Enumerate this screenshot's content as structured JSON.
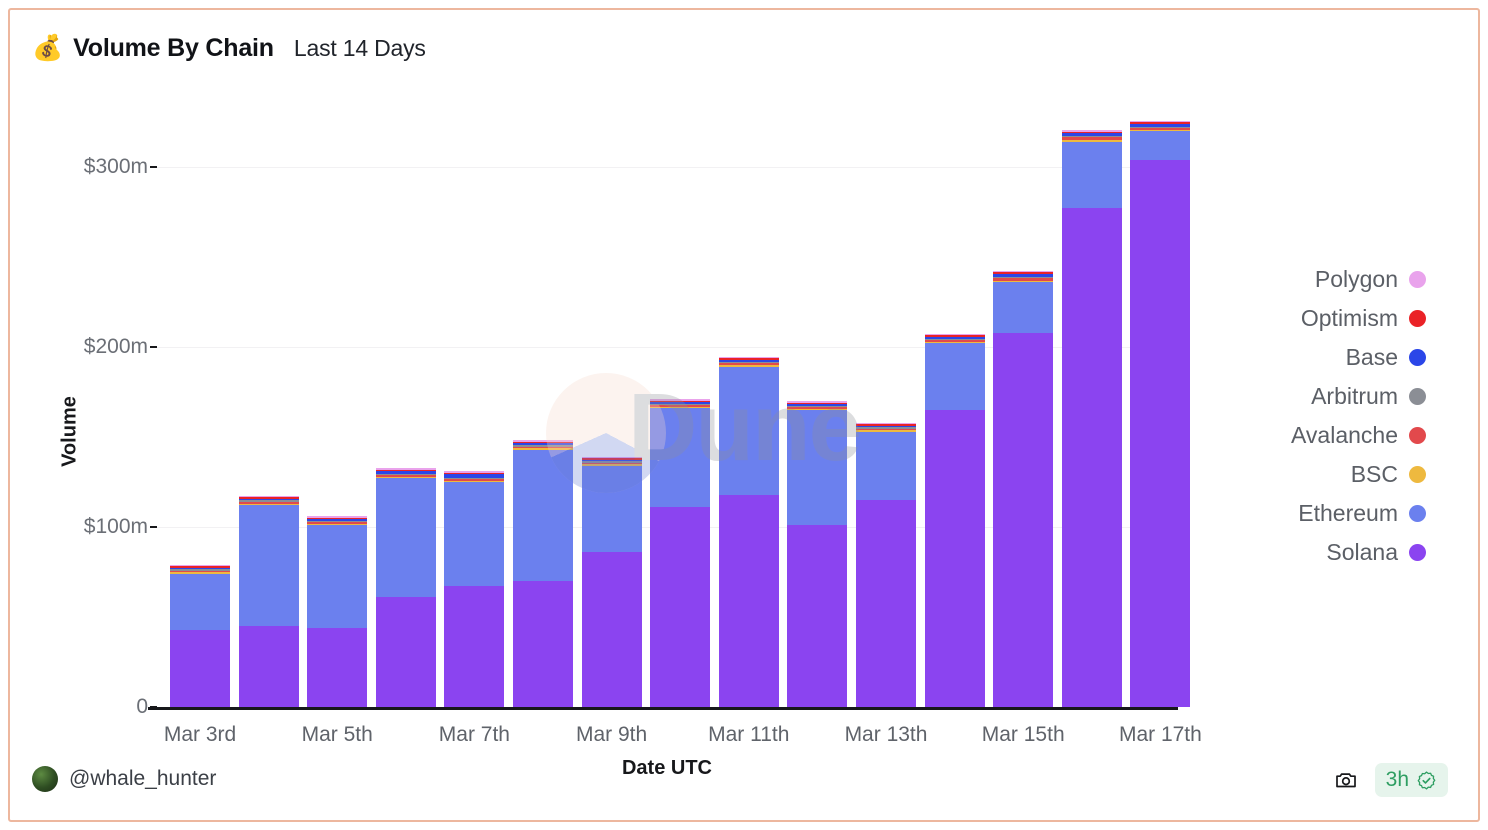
{
  "card": {
    "border_color": "#edb79e",
    "background": "#ffffff"
  },
  "header": {
    "icon": "money-bag-icon",
    "icon_glyph": "💰",
    "title": "Volume By Chain",
    "subtitle": "Last 14 Days"
  },
  "footer": {
    "username": "@whale_hunter",
    "camera_icon": "camera-icon",
    "freshness": "3h",
    "verified_icon": "verified-check-icon"
  },
  "watermark": {
    "text": "Dune"
  },
  "chart_data": {
    "type": "bar",
    "stacked": true,
    "title": "Volume By Chain",
    "subtitle": "Last 14 Days",
    "xlabel": "Date UTC",
    "ylabel": "Volume",
    "ylim": [
      0,
      330
    ],
    "yticks": [
      0,
      100,
      200,
      300
    ],
    "ytick_labels": [
      "0",
      "$100m",
      "$200m",
      "$300m"
    ],
    "units": "USD millions",
    "grid": true,
    "legend_position": "right",
    "categories": [
      "Mar 3rd",
      "Mar 4th",
      "Mar 5th",
      "Mar 6th",
      "Mar 7th",
      "Mar 8th",
      "Mar 9th",
      "Mar 10th",
      "Mar 11th",
      "Mar 12th",
      "Mar 13th",
      "Mar 14th",
      "Mar 15th",
      "Mar 16th",
      "Mar 17th"
    ],
    "xtick_labels": [
      "Mar 3rd",
      "Mar 5th",
      "Mar 7th",
      "Mar 9th",
      "Mar 11th",
      "Mar 13th",
      "Mar 15th",
      "Mar 17th"
    ],
    "xtick_indices": [
      0,
      2,
      4,
      6,
      8,
      10,
      12,
      14
    ],
    "series": [
      {
        "name": "Solana",
        "color": "#8b44f0",
        "values": [
          43,
          45,
          44,
          61,
          67,
          70,
          86,
          111,
          118,
          101,
          115,
          165,
          208,
          277,
          304
        ]
      },
      {
        "name": "Ethereum",
        "color": "#6b80ee",
        "values": [
          31,
          67,
          57,
          66,
          58,
          73,
          48,
          55,
          71,
          64,
          38,
          37,
          28,
          37,
          16
        ]
      },
      {
        "name": "BSC",
        "color": "#eeb93f",
        "values": [
          0.3,
          0.3,
          0.3,
          0.3,
          0.3,
          0.3,
          0.3,
          0.3,
          0.3,
          0.3,
          0.3,
          0.3,
          0.3,
          0.3,
          0.3
        ]
      },
      {
        "name": "Avalanche",
        "color": "#e2494c",
        "values": [
          0.2,
          1.2,
          0.2,
          0.3,
          0.3,
          0.5,
          1.0,
          0.5,
          1.2,
          0.6,
          0.4,
          1.0,
          1.5,
          1.6,
          0.4
        ]
      },
      {
        "name": "Arbitrum",
        "color": "#8b8e95",
        "values": [
          0.2,
          0.2,
          0.2,
          0.2,
          0.2,
          0.2,
          0.2,
          0.2,
          0.2,
          0.2,
          0.2,
          0.2,
          0.2,
          0.2,
          0.2
        ]
      },
      {
        "name": "Base",
        "color": "#2b46e8",
        "values": [
          0.3,
          0.5,
          0.3,
          1.5,
          1.8,
          1.0,
          0.3,
          0.5,
          1.2,
          0.7,
          0.6,
          1.0,
          1.5,
          1.5,
          1.5
        ]
      },
      {
        "name": "Optimism",
        "color": "#ea2227",
        "values": [
          0.1,
          0.1,
          0.1,
          0.1,
          0.1,
          0.1,
          0.1,
          0.1,
          0.1,
          0.1,
          0.1,
          0.1,
          0.1,
          0.1,
          0.1
        ]
      },
      {
        "name": "Polygon",
        "color": "#e9a3ec",
        "values": [
          0.1,
          0.1,
          0.1,
          0.1,
          0.1,
          0.1,
          0.1,
          0.1,
          0.1,
          0.1,
          0.1,
          0.1,
          0.1,
          0.1,
          0.1
        ]
      }
    ],
    "totals": [
      74.9,
      114.1,
      102.1,
      129.4,
      127.4,
      145.1,
      136.0,
      167.6,
      192.1,
      167.0,
      154.3,
      204.6,
      239.6,
      317.6,
      322.5
    ]
  },
  "legend": {
    "items": [
      {
        "label": "Polygon",
        "color": "#e9a3ec"
      },
      {
        "label": "Optimism",
        "color": "#ea2227"
      },
      {
        "label": "Base",
        "color": "#2b46e8"
      },
      {
        "label": "Arbitrum",
        "color": "#8b8e95"
      },
      {
        "label": "Avalanche",
        "color": "#e2494c"
      },
      {
        "label": "BSC",
        "color": "#eeb93f"
      },
      {
        "label": "Ethereum",
        "color": "#6b80ee"
      },
      {
        "label": "Solana",
        "color": "#8b44f0"
      }
    ]
  }
}
